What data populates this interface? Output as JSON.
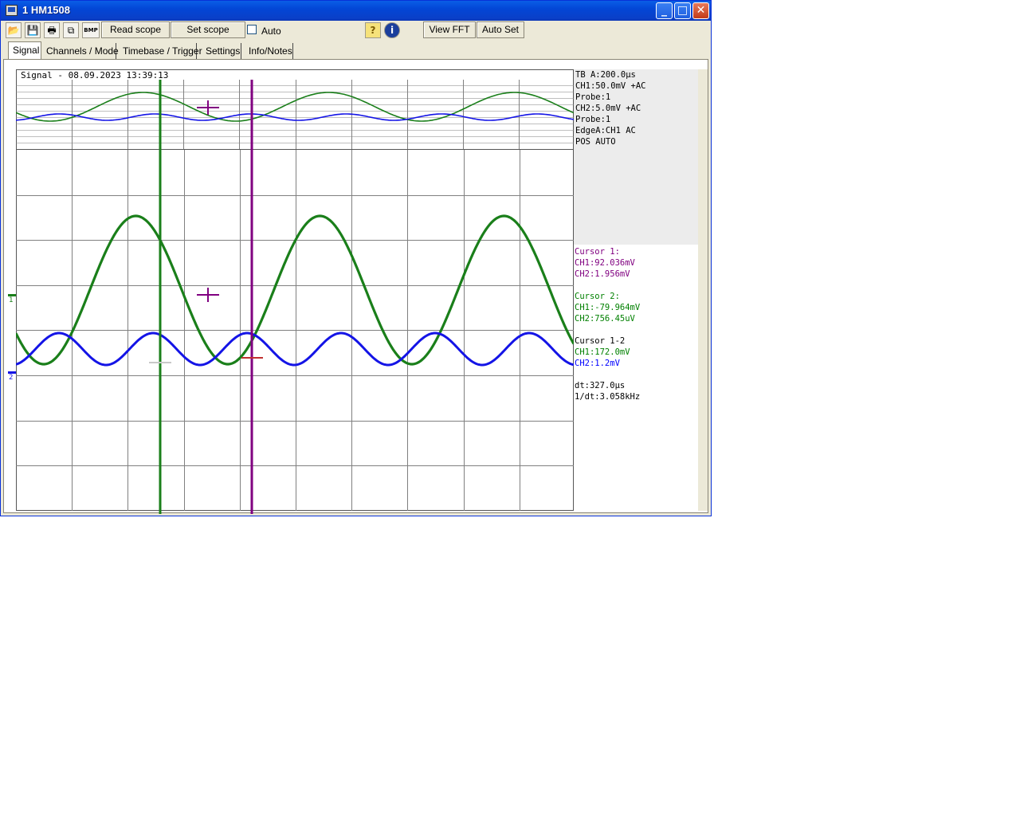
{
  "window": {
    "title": "1 HM1508",
    "controls": {
      "minimize": "_",
      "maximize": "□",
      "close": "✕"
    }
  },
  "toolbar": {
    "icons": [
      {
        "name": "open-folder-icon",
        "glyph": "📂"
      },
      {
        "name": "save-icon",
        "glyph": "💾"
      },
      {
        "name": "print-icon",
        "glyph": "🖶"
      },
      {
        "name": "copy-icon",
        "glyph": "⧉"
      },
      {
        "name": "bmp-icon",
        "glyph": "BMP"
      }
    ],
    "read_scope": "Read scope",
    "set_scope": "Set scope",
    "auto_label": "Auto",
    "auto_checked": false,
    "help_glyph": "?",
    "info_glyph": "i",
    "view_fft": "View FFT",
    "auto_set": "Auto Set"
  },
  "tabs": [
    "Signal",
    "Channels / Mode",
    "Timebase / Trigger",
    "Settings",
    "Info/Notes"
  ],
  "active_tab": 0,
  "signal_title": "Signal - 08.09.2023 13:39:13",
  "channel_markers": {
    "ch1": "1",
    "ch2": "2"
  },
  "settings_info": [
    "TB A:200.0µs",
    "CH1:50.0mV +AC",
    "Probe:1",
    "CH2:5.0mV +AC",
    "Probe:1",
    "EdgeA:CH1 AC",
    "POS AUTO"
  ],
  "cursor_readout": [
    {
      "text": "Cursor 1:",
      "color": "#800080"
    },
    {
      "text": "CH1:92.036mV",
      "color": "#800080"
    },
    {
      "text": "CH2:1.956mV",
      "color": "#800080"
    },
    {
      "text": "",
      "color": "#000"
    },
    {
      "text": "Cursor 2:",
      "color": "#008000"
    },
    {
      "text": "CH1:-79.964mV",
      "color": "#008000"
    },
    {
      "text": "CH2:756.45uV",
      "color": "#008000"
    },
    {
      "text": "",
      "color": "#000"
    },
    {
      "text": "Cursor 1-2",
      "color": "#000000"
    },
    {
      "text": "CH1:172.0mV",
      "color": "#008000"
    },
    {
      "text": "CH2:1.2mV",
      "color": "#0000ff"
    },
    {
      "text": "",
      "color": "#000"
    },
    {
      "text": "dt:327.0µs",
      "color": "#000000"
    },
    {
      "text": "1/dt:3.058kHz",
      "color": "#000000"
    }
  ],
  "colors": {
    "ch1": "#1a7f1a",
    "ch2": "#1414e6",
    "cursor1": "#800080",
    "cursor2": "#1a7f1a",
    "grid": "#808080"
  }
}
